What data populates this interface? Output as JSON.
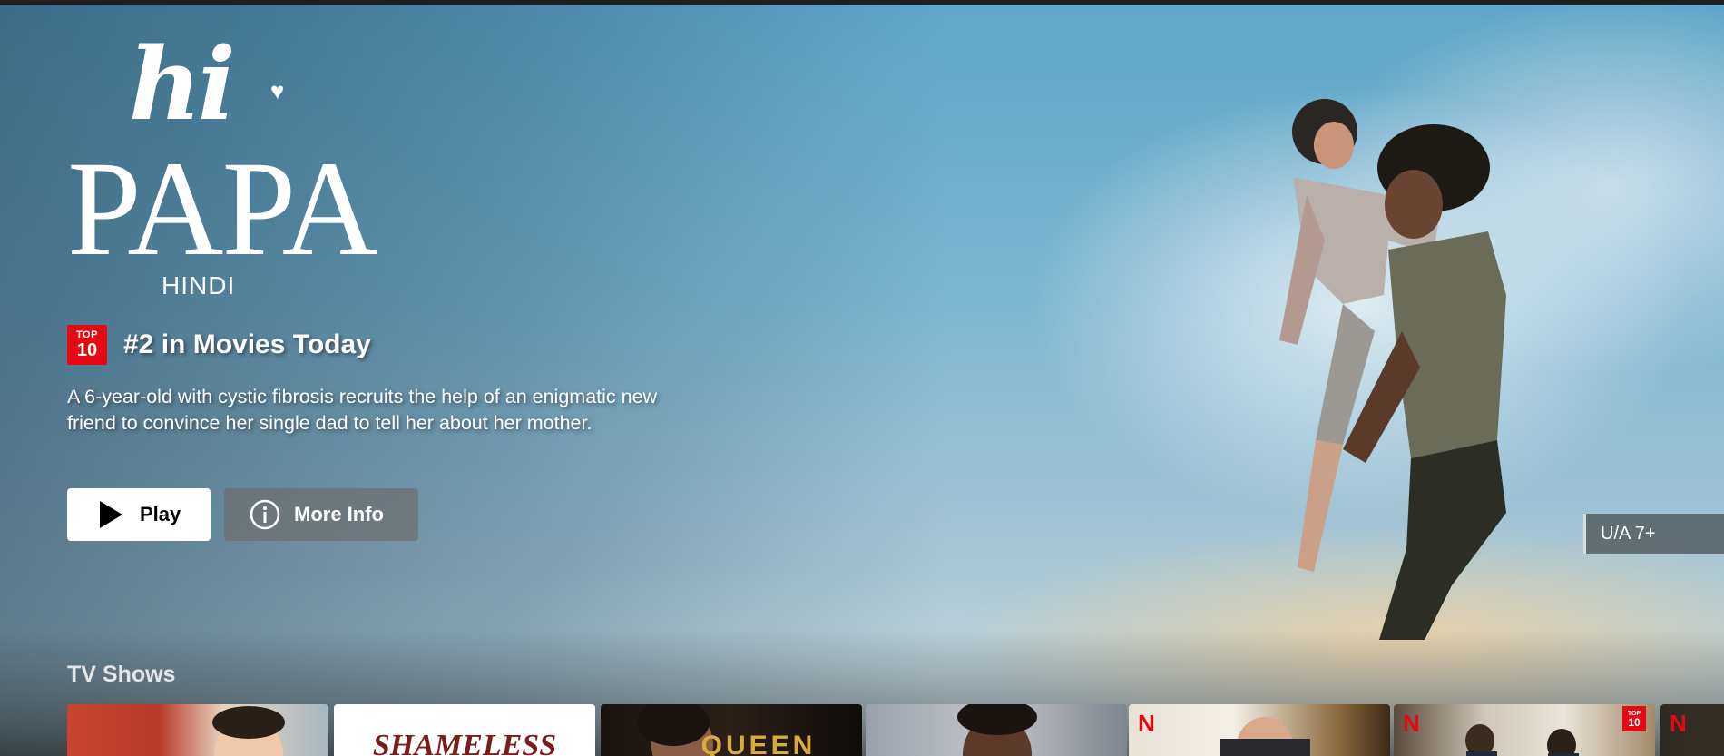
{
  "hero": {
    "logo": {
      "hi": "hi",
      "papa": "PAPA",
      "language": "HINDI"
    },
    "top10_badge": {
      "line1": "TOP",
      "line2": "10"
    },
    "rank_text": "#2 in Movies Today",
    "synopsis": "A 6-year-old with cystic fibrosis recruits the help of an enigmatic new friend to convince her single dad to tell her about her mother.",
    "play_label": "Play",
    "more_info_label": "More Info",
    "maturity_rating": "U/A 7+"
  },
  "row": {
    "title": "TV Shows",
    "cards": [
      {
        "label": ""
      },
      {
        "label": "SHAMELESS"
      },
      {
        "label": "QUEEN"
      },
      {
        "label": ""
      },
      {
        "label": "N"
      },
      {
        "label": "N",
        "badge_line1": "TOP",
        "badge_line2": "10"
      },
      {
        "label": "N"
      }
    ]
  },
  "icons": {
    "play": "play-icon",
    "info": "info-icon",
    "heart": "heart-icon",
    "netflix": "netflix-n-icon"
  },
  "colors": {
    "accent_red": "#e50914",
    "background": "#141414",
    "info_button": "#6d6d6e"
  }
}
